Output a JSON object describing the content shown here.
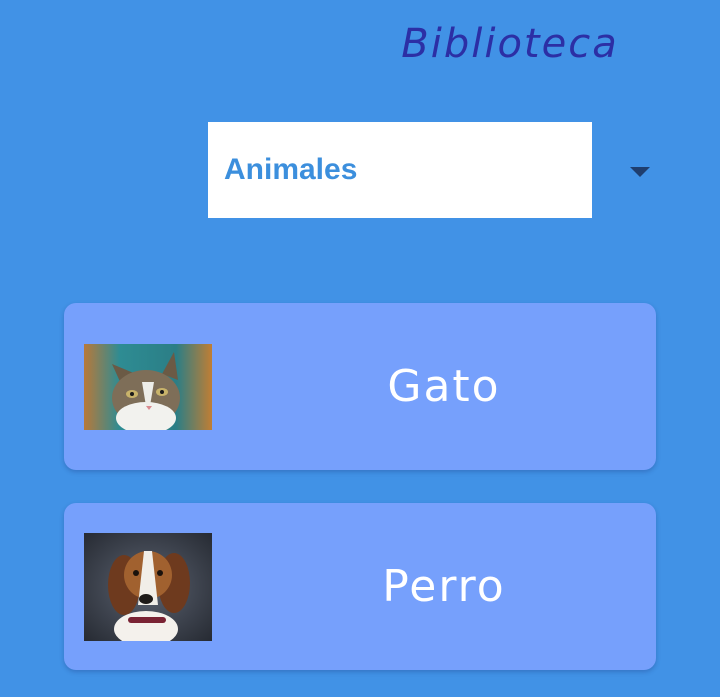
{
  "header": {
    "title": "Biblioteca"
  },
  "category_select": {
    "selected": "Animales",
    "icon": "caret-down-icon"
  },
  "items": [
    {
      "label": "Gato",
      "image": "cat-photo"
    },
    {
      "label": "Perro",
      "image": "beagle-dog-photo"
    }
  ],
  "colors": {
    "background": "#4192E6",
    "title": "#2C2FA5",
    "dropdown_text": "#3C8FDD",
    "card": "#76A0FC",
    "card_text": "#FFFFFF"
  }
}
